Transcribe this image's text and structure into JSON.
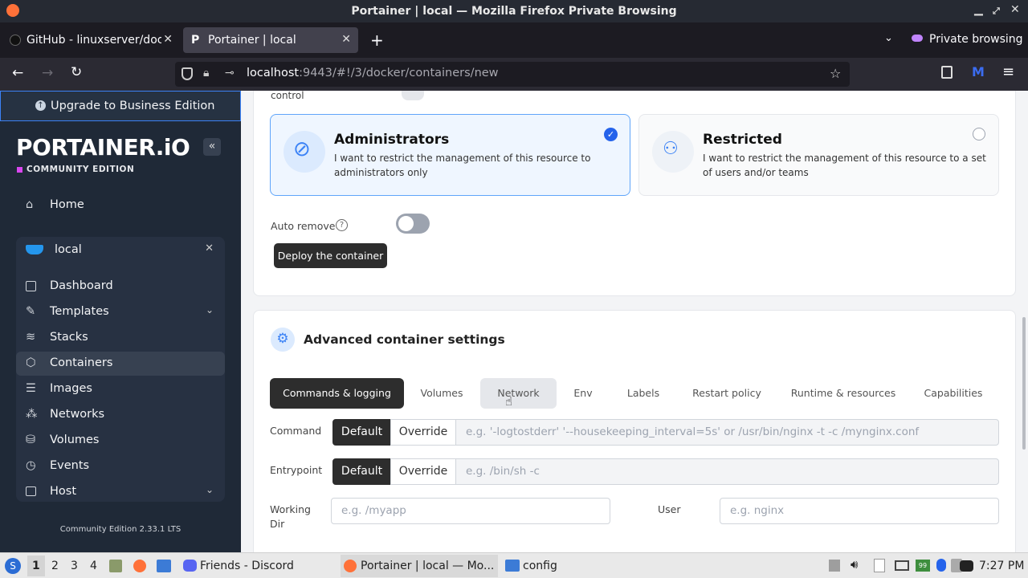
{
  "window": {
    "title": "Portainer | local — Mozilla Firefox Private Browsing"
  },
  "browser": {
    "tabs": [
      {
        "label": "GitHub - linuxserver/dock",
        "active": false
      },
      {
        "label": "Portainer | local",
        "active": true
      }
    ],
    "private_label": "Private browsing",
    "url_host": "localhost",
    "url_rest": ":9443/#!/3/docker/containers/new"
  },
  "sidebar": {
    "upgrade": "Upgrade to Business Edition",
    "logo": "PORTAINER.iO",
    "edition": "COMMUNITY EDITION",
    "home": "Home",
    "env_name": "local",
    "items": [
      {
        "label": "Dashboard",
        "icon": "dashboard-icon"
      },
      {
        "label": "Templates",
        "icon": "templates-icon"
      },
      {
        "label": "Stacks",
        "icon": "stacks-icon"
      },
      {
        "label": "Containers",
        "icon": "containers-icon"
      },
      {
        "label": "Images",
        "icon": "images-icon"
      },
      {
        "label": "Networks",
        "icon": "networks-icon"
      },
      {
        "label": "Volumes",
        "icon": "volumes-icon"
      },
      {
        "label": "Events",
        "icon": "events-icon"
      },
      {
        "label": "Host",
        "icon": "host-icon"
      }
    ],
    "footer": "Community Edition 2.33.1 LTS"
  },
  "access": {
    "control_label": "control",
    "admin": {
      "title": "Administrators",
      "desc": "I want to restrict the management of this resource to administrators only"
    },
    "restricted": {
      "title": "Restricted",
      "desc": "I want to restrict the management of this resource to a set of users and/or teams"
    },
    "auto_remove": "Auto remove",
    "deploy": "Deploy the container"
  },
  "advanced": {
    "title": "Advanced container settings",
    "tabs": [
      "Commands & logging",
      "Volumes",
      "Network",
      "Env",
      "Labels",
      "Restart policy",
      "Runtime & resources",
      "Capabilities"
    ],
    "command_label": "Command",
    "entrypoint_label": "Entrypoint",
    "default": "Default",
    "override": "Override",
    "command_placeholder": "e.g. '-logtostderr' '--housekeeping_interval=5s' or /usr/bin/nginx -t -c /mynginx.conf",
    "entrypoint_placeholder": "e.g. /bin/sh -c",
    "workdir_label_1": "Working",
    "workdir_label_2": "Dir",
    "workdir_placeholder": "e.g. /myapp",
    "user_label": "User",
    "user_placeholder": "e.g. nginx"
  },
  "taskbar": {
    "workspaces": [
      "1",
      "2",
      "3",
      "4"
    ],
    "apps": [
      {
        "label": "Friends - Discord"
      },
      {
        "label": "Portainer | local — Mo..."
      },
      {
        "label": "config"
      }
    ],
    "clock": "7:27 PM"
  },
  "colors": {
    "accent": "#3b82f6",
    "sidebar": "#1f2937",
    "brand": "#d946ef"
  }
}
